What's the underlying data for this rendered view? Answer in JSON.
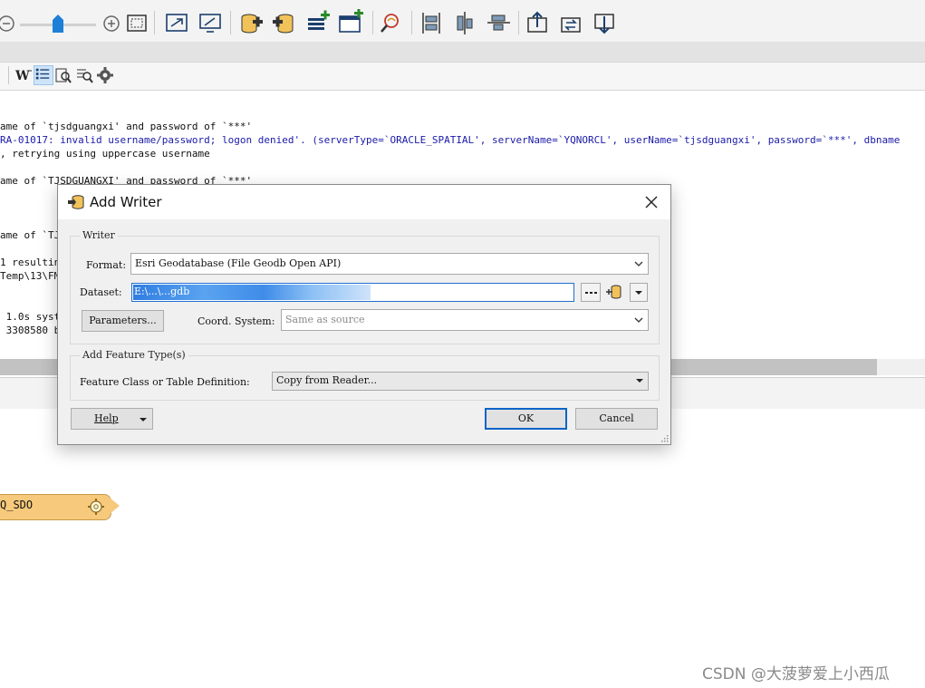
{
  "toolbar": {
    "icons": [
      "zoom-out-icon",
      "zoom-slider",
      "zoom-in-icon",
      "zoom-to-fit-icon",
      "zoom-extents-icon",
      "zoom-window-icon",
      "add-reader-icon",
      "add-writer-icon",
      "add-feature-type-icon",
      "insert-transformer-icon",
      "inspect-icon",
      "align-vertical-icon",
      "align-center-icon",
      "align-horizontal-icon",
      "move-up-icon",
      "refresh-icon",
      "move-down-icon"
    ]
  },
  "log_toolbar": {
    "icons": [
      "wrap-text-icon",
      "list-icon",
      "find-icon",
      "filter-icon",
      "settings-icon"
    ]
  },
  "log": {
    "lines": [
      {
        "text": "ame of `tjsdguangxi' and password of `***'",
        "type": "normal"
      },
      {
        "text": "RA-01017: invalid username/password; logon denied'. (serverType=`ORACLE_SPATIAL', serverName=`YQNORCL', userName=`tjsdguangxi', password=`***', dbname",
        "type": "error"
      },
      {
        "text": ", retrying using uppercase username",
        "type": "normal"
      },
      {
        "text": "ame of `TJSDGUANGXI' and password of `***'",
        "type": "normal"
      },
      {
        "text": "ame of `TJ",
        "type": "normal"
      },
      {
        "text": "1 resultin",
        "type": "normal"
      },
      {
        "text": "Temp\\13\\FM",
        "type": "normal"
      },
      {
        "text": " 1.0s syst",
        "type": "normal"
      },
      {
        "text": " 3308580 b",
        "type": "normal"
      }
    ]
  },
  "canvas": {
    "node_label": "Q_SDO"
  },
  "watermark": "CSDN @大菠萝爱上小西瓜",
  "dialog": {
    "title": "Add Writer",
    "writer_group": "Writer",
    "format_label": "Format:",
    "format_value": "Esri Geodatabase (File Geodb Open API)",
    "dataset_label": "Dataset:",
    "dataset_value": "E:\\...\\...gdb",
    "parameters_button": "Parameters...",
    "coord_label": "Coord. System:",
    "coord_placeholder": "Same as source",
    "feature_group": "Add Feature Type(s)",
    "feature_label": "Feature Class or Table Definition:",
    "feature_value": "Copy from Reader...",
    "help_button": "Help",
    "ok_button": "OK",
    "cancel_button": "Cancel"
  },
  "colors": {
    "accent": "#0a64c8",
    "error_text": "#1a1aa8",
    "node_fill": "#f6c97d"
  }
}
